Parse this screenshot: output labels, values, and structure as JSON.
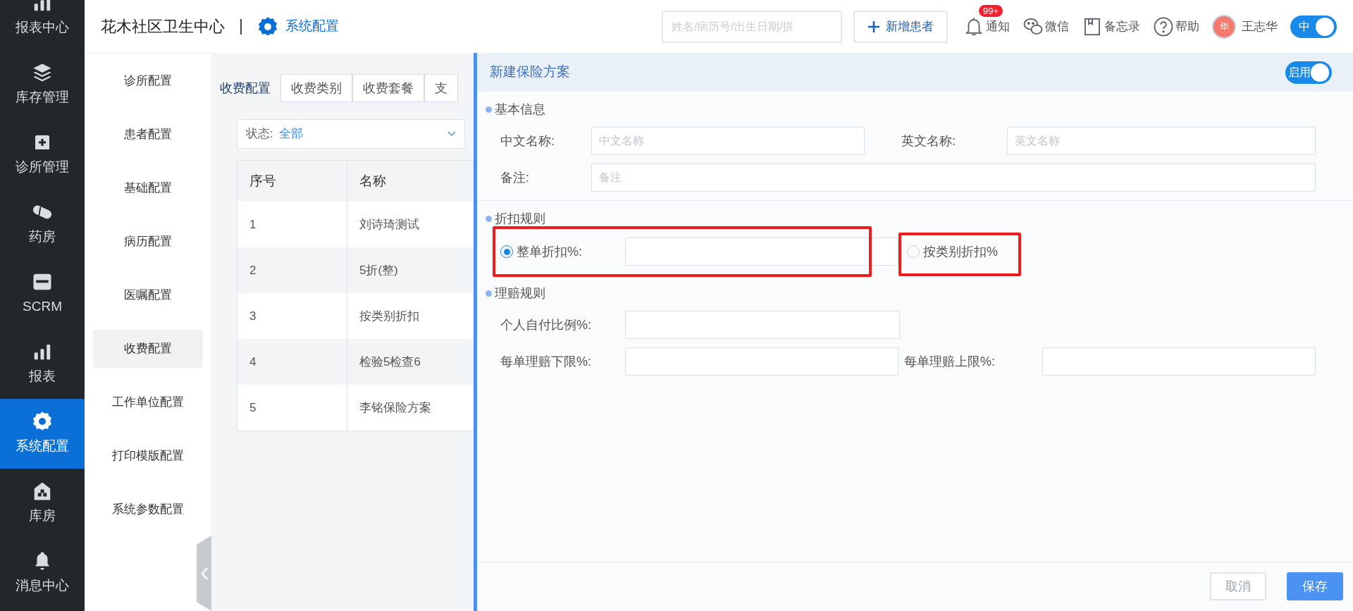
{
  "nav": [
    {
      "label": "报表中心",
      "selected": false
    },
    {
      "label": "库存管理",
      "selected": false
    },
    {
      "label": "诊所管理",
      "selected": false
    },
    {
      "label": "药房",
      "selected": false
    },
    {
      "label": "SCRM",
      "selected": false
    },
    {
      "label": "报表",
      "selected": false
    },
    {
      "label": "系统配置",
      "selected": true
    },
    {
      "label": "库房",
      "selected": false
    },
    {
      "label": "消息中心",
      "selected": false
    }
  ],
  "header": {
    "clinic": "花木社区卫生中心",
    "section": "系统配置",
    "search": {
      "placeholder": "姓名/病历号/出生日期/拼"
    },
    "new_patient": "新增患者",
    "tools": [
      {
        "label": "通知",
        "badge": "99+"
      },
      {
        "label": "微信"
      },
      {
        "label": "备忘录"
      },
      {
        "label": "帮助"
      }
    ],
    "user": {
      "avatar": "华",
      "name": "王志华"
    },
    "lang_toggle": {
      "label": "中",
      "on": true
    }
  },
  "subnav": [
    {
      "label": "诊所配置",
      "selected": false
    },
    {
      "label": "患者配置",
      "selected": false
    },
    {
      "label": "基础配置",
      "selected": false
    },
    {
      "label": "病历配置",
      "selected": false
    },
    {
      "label": "医嘱配置",
      "selected": false
    },
    {
      "label": "收费配置",
      "selected": true
    },
    {
      "label": "工作单位配置",
      "selected": false
    },
    {
      "label": "打印模版配置",
      "selected": false
    },
    {
      "label": "系统参数配置",
      "selected": false
    }
  ],
  "tabs": [
    {
      "label": "收费配置",
      "selected": true
    },
    {
      "label": "收费类别",
      "selected": false
    },
    {
      "label": "收费套餐",
      "selected": false
    },
    {
      "label": "支",
      "selected": false
    }
  ],
  "filter": {
    "label": "状态:",
    "value": "全部"
  },
  "table": {
    "columns": [
      "序号",
      "名称"
    ],
    "rows": [
      [
        "1",
        "刘诗琦测试"
      ],
      [
        "2",
        "5折(整)"
      ],
      [
        "3",
        "按类别折扣"
      ],
      [
        "4",
        "检验5检查6"
      ],
      [
        "5",
        "李铭保险方案"
      ]
    ]
  },
  "drawer": {
    "title": "新建保险方案",
    "enabled": {
      "label": "启用",
      "on": true
    },
    "basic": {
      "title": "基本信息",
      "cn_label": "中文名称:",
      "cn_placeholder": "中文名称",
      "en_label": "英文名称:",
      "en_placeholder": "英文名称",
      "note_label": "备注:",
      "note_placeholder": "备注"
    },
    "discount": {
      "title": "折扣规则",
      "options": [
        {
          "label": "整单折扣%:",
          "selected": true
        },
        {
          "label": "按类别折扣%",
          "selected": false
        }
      ]
    },
    "claims": {
      "title": "理赔规则",
      "self_pay": "个人自付比例%:",
      "min": "每单理赔下限%:",
      "max": "每单理赔上限%:"
    },
    "cancel": "取消",
    "save": "保存"
  }
}
